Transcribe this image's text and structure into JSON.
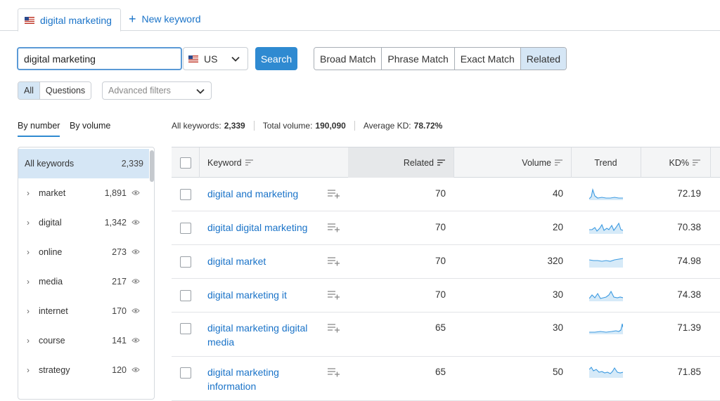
{
  "tabs": {
    "active_label": "digital marketing",
    "new_label": "New keyword"
  },
  "search": {
    "query": "digital marketing",
    "database": "US",
    "search_label": "Search"
  },
  "match_options": [
    {
      "label": "Broad Match",
      "active": false
    },
    {
      "label": "Phrase Match",
      "active": false
    },
    {
      "label": "Exact Match",
      "active": false
    },
    {
      "label": "Related",
      "active": true
    }
  ],
  "filters": {
    "all_label": "All",
    "questions_label": "Questions",
    "advanced_label": "Advanced filters"
  },
  "group_toggle": {
    "by_number": "By number",
    "by_volume": "By volume"
  },
  "summary": {
    "all_keywords_label": "All keywords:",
    "all_keywords_value": "2,339",
    "total_volume_label": "Total volume:",
    "total_volume_value": "190,090",
    "avg_kd_label": "Average KD:",
    "avg_kd_value": "78.72%"
  },
  "sidebar": {
    "items": [
      {
        "label": "All keywords",
        "count": "2,339",
        "active": true
      },
      {
        "label": "market",
        "count": "1,891"
      },
      {
        "label": "digital",
        "count": "1,342"
      },
      {
        "label": "online",
        "count": "273"
      },
      {
        "label": "media",
        "count": "217"
      },
      {
        "label": "internet",
        "count": "170"
      },
      {
        "label": "course",
        "count": "141"
      },
      {
        "label": "strategy",
        "count": "120"
      }
    ]
  },
  "table": {
    "headers": {
      "keyword": "Keyword",
      "related": "Related",
      "volume": "Volume",
      "trend": "Trend",
      "kd": "KD%"
    },
    "rows": [
      {
        "keyword": "digital and marketing",
        "related": "70",
        "volume": "40",
        "kd": "72.19"
      },
      {
        "keyword": "digital digital marketing",
        "related": "70",
        "volume": "20",
        "kd": "70.38"
      },
      {
        "keyword": "digital market",
        "related": "70",
        "volume": "320",
        "kd": "74.98"
      },
      {
        "keyword": "digital marketing it",
        "related": "70",
        "volume": "30",
        "kd": "74.38"
      },
      {
        "keyword": "digital marketing digital media",
        "related": "65",
        "volume": "30",
        "kd": "71.39"
      },
      {
        "keyword": "digital marketing information",
        "related": "65",
        "volume": "50",
        "kd": "71.85"
      }
    ]
  },
  "colors": {
    "accent": "#2f8ad1",
    "link": "#1a73c8",
    "selected_bg": "#d5e6f5",
    "sparkline": "#3b9ae1"
  }
}
